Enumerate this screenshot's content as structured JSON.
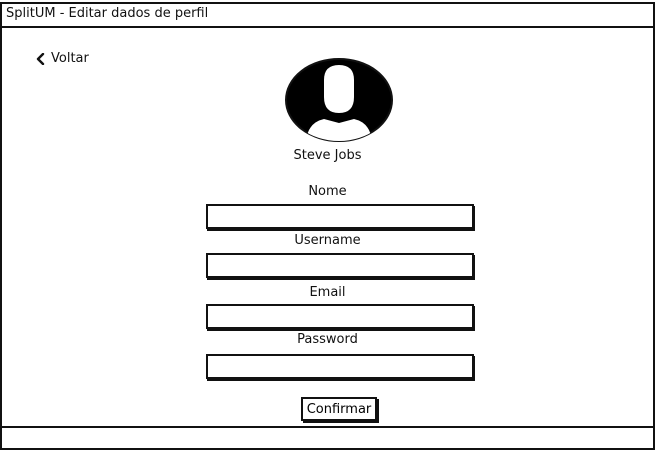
{
  "window": {
    "title": "SplitUM - Editar dados de perfil"
  },
  "nav": {
    "back_label": "Voltar",
    "back_icon": "chevron-left-icon"
  },
  "profile": {
    "name": "Steve Jobs",
    "avatar_icon": "user-avatar-icon"
  },
  "form": {
    "fields": [
      {
        "label": "Nome",
        "value": "",
        "placeholder": ""
      },
      {
        "label": "Username",
        "value": "",
        "placeholder": ""
      },
      {
        "label": "Email",
        "value": "",
        "placeholder": ""
      },
      {
        "label": "Password",
        "value": "",
        "placeholder": ""
      }
    ],
    "confirm_label": "Confirmar"
  }
}
